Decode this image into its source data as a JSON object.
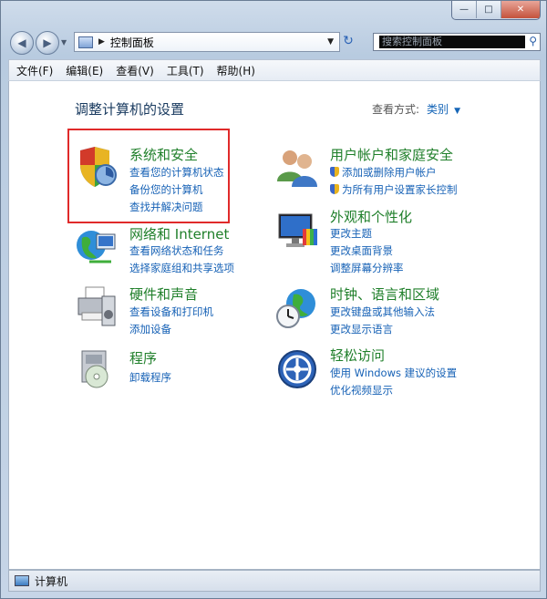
{
  "window": {
    "controls": {
      "minimize": "—",
      "maximize": "□",
      "close": "✕"
    }
  },
  "address": {
    "breadcrumb": "控制面板",
    "search_placeholder": "搜索控制面板"
  },
  "menu": [
    "文件(F)",
    "编辑(E)",
    "查看(V)",
    "工具(T)",
    "帮助(H)"
  ],
  "main": {
    "title": "调整计算机的设置",
    "view_label": "查看方式:",
    "view_value": "类别"
  },
  "categories": [
    {
      "title": "系统和安全",
      "links": [
        "查看您的计算机状态",
        "备份您的计算机",
        "查找并解决问题"
      ],
      "icon": "security-shield-icon"
    },
    {
      "title": "网络和 Internet",
      "links": [
        "查看网络状态和任务",
        "选择家庭组和共享选项"
      ],
      "icon": "network-globe-icon"
    },
    {
      "title": "硬件和声音",
      "links": [
        "查看设备和打印机",
        "添加设备"
      ],
      "icon": "printer-icon"
    },
    {
      "title": "程序",
      "links": [
        "卸载程序"
      ],
      "icon": "programs-icon"
    },
    {
      "title": "用户帐户和家庭安全",
      "links": [
        "添加或删除用户帐户",
        "为所有用户设置家长控制"
      ],
      "icon": "users-icon"
    },
    {
      "title": "外观和个性化",
      "links": [
        "更改主题",
        "更改桌面背景",
        "调整屏幕分辨率"
      ],
      "icon": "monitor-icon"
    },
    {
      "title": "时钟、语言和区域",
      "links": [
        "更改键盘或其他输入法",
        "更改显示语言"
      ],
      "icon": "clock-globe-icon"
    },
    {
      "title": "轻松访问",
      "links": [
        "使用 Windows 建议的设置",
        "优化视频显示"
      ],
      "icon": "ease-of-access-icon"
    }
  ],
  "status": {
    "text": "计算机"
  },
  "colors": {
    "category_title": "#1f7f2a",
    "link": "#1762b6",
    "highlight": "#e02a2a"
  }
}
